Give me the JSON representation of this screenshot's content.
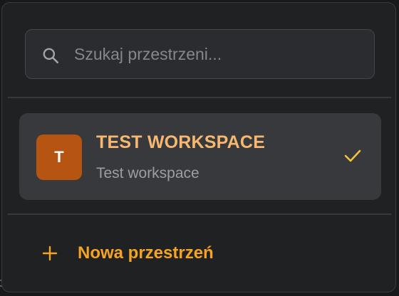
{
  "search": {
    "placeholder": "Szukaj przestrzeni...",
    "icon": "search-icon"
  },
  "workspaces": [
    {
      "initial": "T",
      "name": "TEST WORKSPACE",
      "description": "Test workspace",
      "selected": true,
      "avatar_color": "#b65411"
    }
  ],
  "actions": {
    "new_workspace_label": "Nowa przestrzeń",
    "new_workspace_icon": "plus-icon"
  },
  "background": {
    "edge_text": "C"
  },
  "colors": {
    "accent": "#f5a323",
    "name": "#f6b771",
    "check": "#f3c23a",
    "panel": "#202123",
    "item": "#38393c"
  }
}
